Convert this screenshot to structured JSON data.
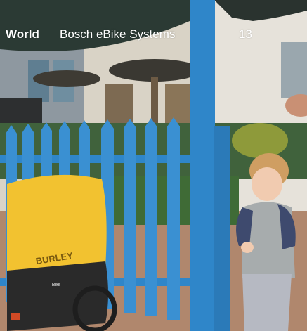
{
  "header": {
    "brand": "World",
    "company": "Bosch eBike Systems",
    "page_number": "13"
  },
  "trailer": {
    "brand_text": "BURLEY",
    "model_text": "Bee"
  },
  "colors": {
    "fence_blue": "#2f86c9",
    "trailer_yellow": "#f2c230",
    "child_sweater_gray": "#a7acad",
    "child_sleeve_navy": "#3e4a6e",
    "patio_brick": "#b0876d"
  }
}
